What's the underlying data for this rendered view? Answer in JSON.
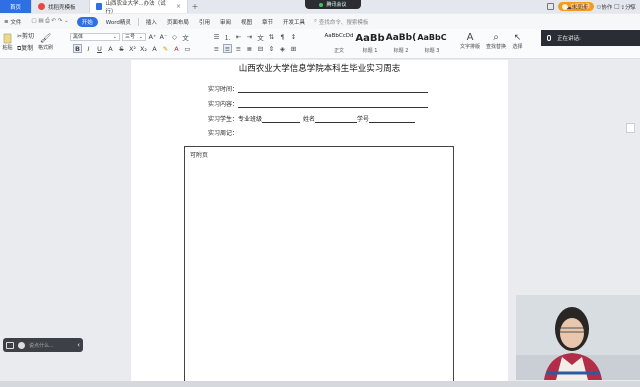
{
  "titlebar": {
    "home_tab": "首页",
    "tabs": [
      {
        "label": "找稻壳模板",
        "icon": "wps-template-icon",
        "color": "#e24c3f"
      },
      {
        "label": "山西农业大学...办法（试行）",
        "icon": "wps-writer-icon",
        "color": "#2f6fe4"
      }
    ],
    "meeting_label": "腾讯会议",
    "login_label": "立即登录"
  },
  "menubar": {
    "file": "文件",
    "items": [
      "开始",
      "Word精灵",
      "插入",
      "页面布局",
      "引用",
      "审阅",
      "视图",
      "章节",
      "开发工具"
    ],
    "search_placeholder": "查找命令、搜索模板",
    "right_items": [
      "未同步",
      "协作",
      "分享"
    ]
  },
  "toolbar": {
    "paste": "粘贴",
    "cut": "剪切",
    "copy": "复制",
    "format_painter": "格式刷",
    "font_name": "黑体",
    "font_size": "三号",
    "styles": [
      {
        "sample": "AaBbCcDd",
        "label": "正文"
      },
      {
        "sample": "AaBb",
        "label": "标题 1"
      },
      {
        "sample": "AaBb(",
        "label": "标题 2"
      },
      {
        "sample": "AaBbC",
        "label": "标题 3"
      }
    ],
    "text_layout": "文字排版",
    "find_replace": "查找替换",
    "select": "选择"
  },
  "voice": {
    "status": "正在讲话:"
  },
  "document": {
    "title": "山西农业大学信息学院本科生毕业实习周志",
    "field_time": "实习时间：",
    "field_content": "实习内容：",
    "field_student": "实习学生：",
    "class_label": "专业班级",
    "name_label": "姓名",
    "id_label": "学号",
    "field_weekly": "实习周记：",
    "attach_note": "可附页"
  },
  "chat": {
    "placeholder": "说点什么..."
  },
  "colors": {
    "accent": "#2f6fe4",
    "login": "#f39a1f"
  }
}
